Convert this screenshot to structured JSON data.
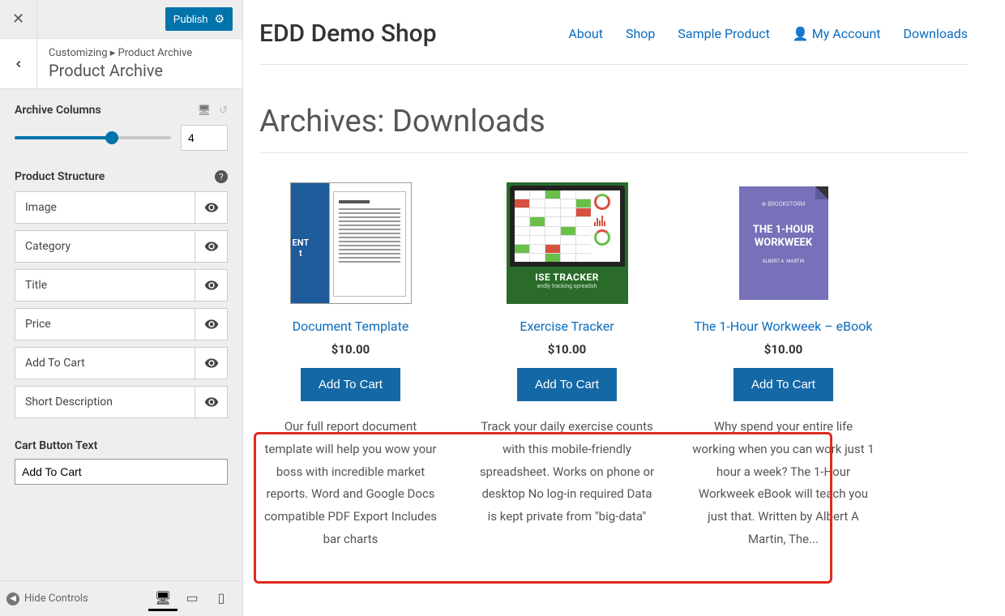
{
  "sidebar": {
    "publish_label": "Publish",
    "breadcrumb": "Customizing ▸ Product Archive",
    "section_title": "Product Archive",
    "archive_columns": {
      "label": "Archive Columns",
      "value": "4"
    },
    "product_structure": {
      "label": "Product Structure",
      "items": [
        {
          "label": "Image"
        },
        {
          "label": "Category"
        },
        {
          "label": "Title"
        },
        {
          "label": "Price"
        },
        {
          "label": "Add To Cart"
        },
        {
          "label": "Short Description"
        }
      ]
    },
    "cart_button_text": {
      "label": "Cart Button Text",
      "value": "Add To Cart"
    },
    "hide_controls_label": "Hide Controls"
  },
  "preview": {
    "site_title": "EDD Demo Shop",
    "nav": {
      "about": "About",
      "shop": "Shop",
      "sample_product": "Sample Product",
      "my_account": "My Account",
      "downloads": "Downloads"
    },
    "archive_title": "Archives: Downloads",
    "products": [
      {
        "title": "Document Template",
        "price": "$10.00",
        "button": "Add To Cart",
        "desc": "Our full report document template will help you wow your boss with incredible market reports. Word and Google Docs compatible PDF Export Includes bar charts"
      },
      {
        "title": "Exercise Tracker",
        "price": "$10.00",
        "button": "Add To Cart",
        "desc": "Track your daily exercise counts with this mobile-friendly spreadsheet. Works on phone or desktop No log-in required Data is kept private from \"big-data\""
      },
      {
        "title": "The 1-Hour Workweek – eBook",
        "price": "$10.00",
        "button": "Add To Cart",
        "desc": "Why spend your entire life working when you can work just 1 hour a week? The 1-Hour Workweek eBook will teach you just that. Written by Albert A Martin, The..."
      }
    ]
  },
  "thumbs": {
    "p1_label": "ENT",
    "p2_label1": "ISE TRACKER",
    "p2_label2": "endly tracking spreadsh",
    "p3_logo": "⊕ BROOKSTORM",
    "p3_title": "THE 1-HOUR WORKWEEK",
    "p3_author": "ALBERT A. MARTIN"
  }
}
